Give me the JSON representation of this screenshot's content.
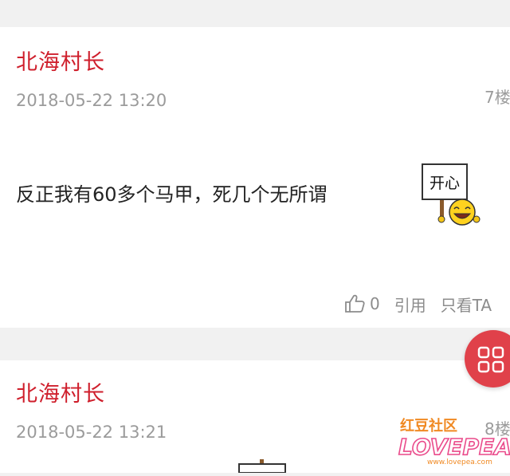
{
  "posts": [
    {
      "author": "北海村长",
      "time": "2018-05-22 13:20",
      "floor": "7楼",
      "content": "反正我有60多个马甲，死几个无所谓",
      "emoji_sign": "开心",
      "likes": "0",
      "quote_label": "引用",
      "only_label": "只看TA"
    },
    {
      "author": "北海村长",
      "time": "2018-05-22 13:21",
      "floor": "8楼"
    }
  ],
  "watermark": {
    "top": "红豆社区",
    "logo": "LOVEPEA",
    "url": "www.lovepea.com"
  },
  "colors": {
    "author": "#cf1f2c",
    "fab": "#e0414a",
    "watermark_orange": "#f08a24",
    "watermark_pink": "#ea4b8b"
  }
}
